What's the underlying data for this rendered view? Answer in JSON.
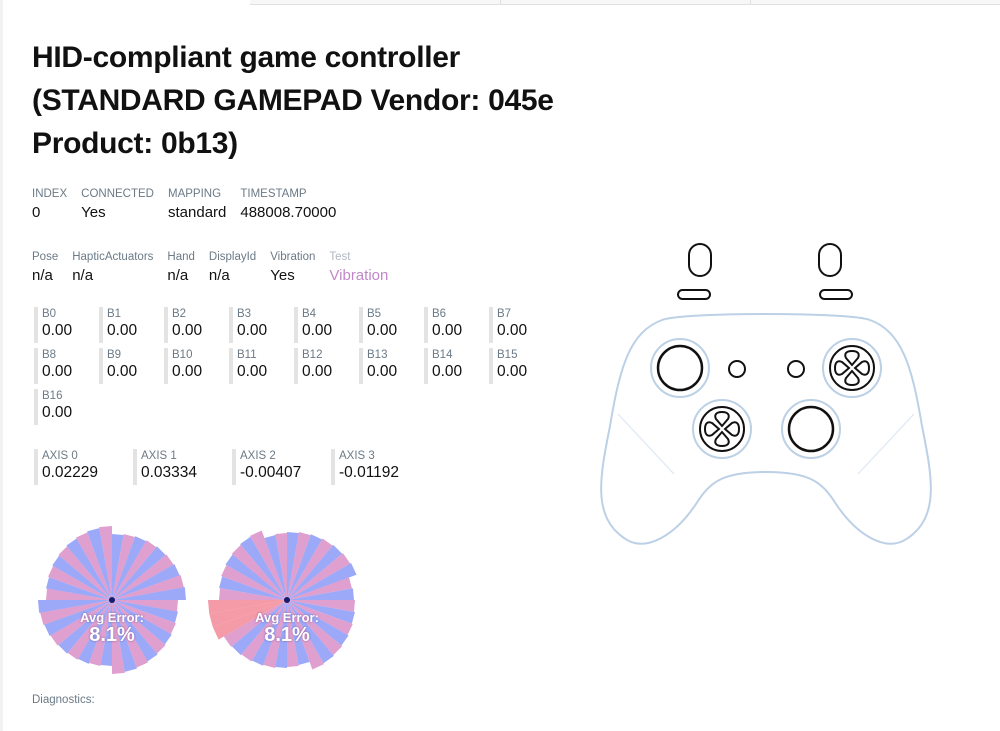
{
  "title": "HID-compliant game controller (STANDARD GAMEPAD Vendor: 045e Product: 0b13)",
  "info1": [
    {
      "label": "INDEX",
      "value": "0"
    },
    {
      "label": "CONNECTED",
      "value": "Yes"
    },
    {
      "label": "MAPPING",
      "value": "standard"
    },
    {
      "label": "TIMESTAMP",
      "value": "488008.70000"
    }
  ],
  "info2": [
    {
      "label": "Pose",
      "value": "n/a"
    },
    {
      "label": "HapticActuators",
      "value": "n/a"
    },
    {
      "label": "Hand",
      "value": "n/a"
    },
    {
      "label": "DisplayId",
      "value": "n/a"
    },
    {
      "label": "Vibration",
      "value": "Yes"
    },
    {
      "label": "Test",
      "value": "Vibration"
    }
  ],
  "buttons": [
    {
      "label": "B0",
      "value": "0.00"
    },
    {
      "label": "B1",
      "value": "0.00"
    },
    {
      "label": "B2",
      "value": "0.00"
    },
    {
      "label": "B3",
      "value": "0.00"
    },
    {
      "label": "B4",
      "value": "0.00"
    },
    {
      "label": "B5",
      "value": "0.00"
    },
    {
      "label": "B6",
      "value": "0.00"
    },
    {
      "label": "B7",
      "value": "0.00"
    },
    {
      "label": "B8",
      "value": "0.00"
    },
    {
      "label": "B9",
      "value": "0.00"
    },
    {
      "label": "B10",
      "value": "0.00"
    },
    {
      "label": "B11",
      "value": "0.00"
    },
    {
      "label": "B12",
      "value": "0.00"
    },
    {
      "label": "B13",
      "value": "0.00"
    },
    {
      "label": "B14",
      "value": "0.00"
    },
    {
      "label": "B15",
      "value": "0.00"
    },
    {
      "label": "B16",
      "value": "0.00"
    }
  ],
  "axes": [
    {
      "label": "AXIS 0",
      "value": "0.02229"
    },
    {
      "label": "AXIS 1",
      "value": "0.03334"
    },
    {
      "label": "AXIS 2",
      "value": "-0.00407"
    },
    {
      "label": "AXIS 3",
      "value": "-0.01192"
    }
  ],
  "sticks": [
    {
      "avg_error_label": "Avg Error:",
      "avg_error_value": "8.1%"
    },
    {
      "avg_error_label": "Avg Error:",
      "avg_error_value": "8.1%"
    }
  ],
  "diagnostics_label": "Diagnostics:",
  "colors": {
    "stick_blue": "#7b8cf5",
    "stick_pink": "#d47fbf",
    "stick_red": "#f07a8a",
    "gamepad_outline": "#bcd0e6",
    "link": "#c088c8"
  }
}
